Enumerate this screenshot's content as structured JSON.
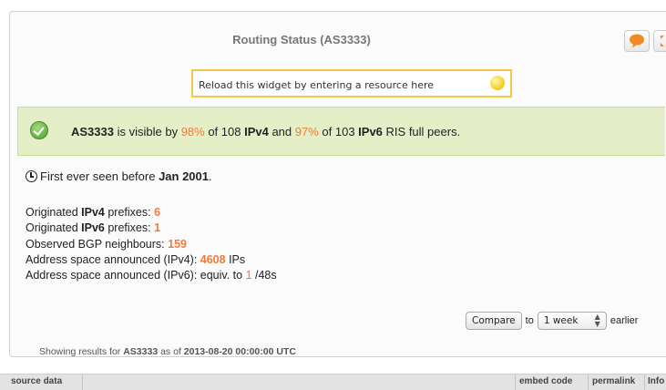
{
  "widget": {
    "title": "Routing Status (AS3333)",
    "reload_placeholder": "Reload this widget by entering a resource here"
  },
  "banner": {
    "asn": "AS3333",
    "t1": " is visible by ",
    "ipv4_pct": "98%",
    "t2": " of 108 ",
    "ipv4": "IPv4",
    "t3": " and ",
    "ipv6_pct": "97%",
    "t4": " of 103 ",
    "ipv6": "IPv6",
    "t5": " RIS full peers."
  },
  "first_seen": {
    "prefix": "First ever seen before ",
    "date": "Jan 2001",
    "suffix": "."
  },
  "stats": {
    "orig_v4_a": "Originated ",
    "orig_v4_b": "IPv4",
    "orig_v4_c": " prefixes: ",
    "orig_v4_val": "6",
    "orig_v6_a": "Originated ",
    "orig_v6_b": "IPv6",
    "orig_v6_c": " prefixes: ",
    "orig_v6_val": "1",
    "bgp_label": "Observed BGP neighbours: ",
    "bgp_val": "159",
    "addr_v4_label": "Address space announced (IPv4): ",
    "addr_v4_val": "4608",
    "addr_v4_unit": " IPs",
    "addr_v6_label": "Address space announced (IPv6): equiv. to ",
    "addr_v6_val": "1",
    "addr_v6_unit": " /48s"
  },
  "compare": {
    "button": "Compare",
    "to": "to",
    "period": "1 week",
    "earlier": "earlier"
  },
  "showing": {
    "prefix": "Showing results for ",
    "asn": "AS3333",
    "mid": " as of ",
    "datetime": "2013-08-20 00:00:00 UTC"
  },
  "footer": {
    "source_data": "source data",
    "embed_code": "embed code",
    "permalink": "permalink",
    "info": "Info"
  },
  "colors": {
    "accent": "#f27a3c",
    "banner_bg": "#e4efc7",
    "reload_border": "#f5c842",
    "comment_icon": "#f08a24"
  }
}
